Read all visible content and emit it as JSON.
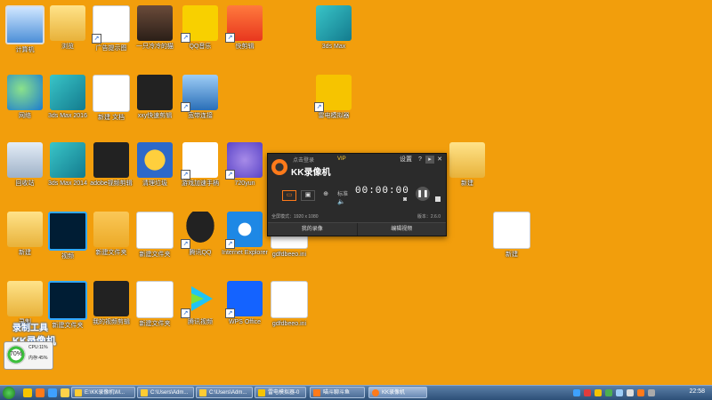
{
  "desktop": {
    "row1": [
      "计算机",
      "浏览",
      "广告提示图",
      "一只冷冷的猫",
      "QQ音乐",
      "快剪辑",
      "3ds Max"
    ],
    "row2": [
      "网络",
      "3ds Max 2016",
      "新建 文档",
      "xxy快速剪辑",
      "宽带连接",
      "雷电模拟器"
    ],
    "row3": [
      "回收站",
      "3ds Max 2014",
      "adobe视频剪辑",
      "清理垃圾",
      "游戏加速手柄",
      "720yun",
      "新建"
    ],
    "row4": [
      "新建",
      "视频",
      "新建文件夹",
      "新建文件夹",
      "腾讯QQ",
      "Internet Explorer",
      "gdfdbeeo.ini",
      "新建"
    ],
    "row5": [
      "录制",
      "新建文件夹",
      "我的视频剪辑",
      "新建文件夹",
      "腾讯视频",
      "WPS Office",
      "gdfdbeeo.ini"
    ]
  },
  "icons": {
    "computer": "computer-icon",
    "folder": "folder-icon",
    "doc": "document-icon",
    "max": "3dsmax-icon",
    "ps": "photoshop-icon",
    "qq": "qq-penguin-icon",
    "ie": "internet-explorer-icon",
    "wps": "wps-icon"
  },
  "kk": {
    "top_left": "点击登录",
    "vip": "VIP",
    "settings": "设置",
    "help": "?",
    "min": "▸",
    "close": "✕",
    "title": "KK录像机",
    "mode_label": "标准",
    "time": "00:00:00",
    "pause": "❚❚",
    "capture_info": "全屏模式：1920 x 1080",
    "version": "版本：2.6.0",
    "btn_left": "我的录像",
    "btn_right": "编辑视频"
  },
  "watermark": {
    "line1": "录制工具",
    "line2": "KK录像机"
  },
  "monitor": {
    "gauge": "70%",
    "cpu": "CPU:11%",
    "mem": "内存:45%"
  },
  "taskbar": {
    "tasks": [
      "E:\\KK录像机\\M...",
      "C:\\Users\\Adm...",
      "C:\\Users\\Adm...",
      "雷电模拟器-0",
      "喵斗聊斗鱼",
      "KK录像机"
    ],
    "clock": "22:58"
  },
  "colors": {
    "desktop": "#F29E0C",
    "accent": "#FF7A1A",
    "taskbar": "#2D4F77"
  }
}
